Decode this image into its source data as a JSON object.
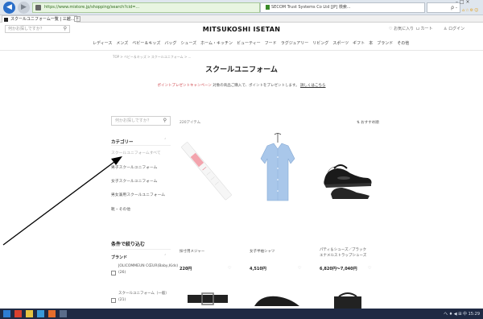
{
  "browser": {
    "url": "https://www.mistore.jp/shopping/search?cid=...",
    "cert_text": "SECOM Trust Systems Co Ltd [JP]",
    "cert_suffix": "検索...",
    "search_placeholder": "ρ -",
    "tab_title": "スクールユニフォーム一覧 | 三越...",
    "win_controls": "– □ ×",
    "toolbar_icons": "⌂☆⚙☺"
  },
  "site": {
    "search_placeholder": "何かお探しですか？",
    "logo": "MITSUKOSHI ISETAN",
    "header_links": [
      "お気に入り",
      "カート",
      "ログイン"
    ],
    "global_nav": [
      "レディース",
      "メンズ",
      "ベビー＆キッズ",
      "バッグ",
      "シューズ",
      "ホーム・キッチン",
      "ビューティー",
      "フード",
      "ラグジュアリー",
      "リビング",
      "スポーツ",
      "ギフト",
      "本",
      "ブランド",
      "その他"
    ],
    "breadcrumb": "TOP > ベビー＆キッズ > スクールユニフォーム > ...",
    "page_title": "スクールユニフォーム",
    "banner": {
      "highlight": "ポイントプレゼントキャンペーン",
      "text": "対象の商品ご購入で、ポイントをプレゼントします。",
      "link": "詳しくはこちら"
    }
  },
  "sidebar": {
    "search_placeholder": "何かお探しですか？",
    "category_heading": "カテゴリー",
    "categories": [
      {
        "label": "スクールユニフォームすべて",
        "current": true
      },
      {
        "label": "男子スクールユニフォーム",
        "current": false
      },
      {
        "label": "女子スクールユニフォーム",
        "current": false
      },
      {
        "label": "男女兼用スクールユニフォーム",
        "current": false
      },
      {
        "label": "靴・その他",
        "current": false
      }
    ],
    "filter_heading": "条件で絞り込む",
    "brand_heading": "ブランド",
    "brands": [
      {
        "label": "JOLICOMMEUN CŒUR(Baby,Kids)",
        "sub": "(26)"
      },
      {
        "label": "スクールユニフォーム（一般）",
        "sub": "(21)"
      }
    ]
  },
  "results": {
    "count": "220アイテム",
    "sort": "おすすめ順"
  },
  "products": [
    {
      "name": "採寸用メジャー",
      "price": "220円"
    },
    {
      "name": "女子半袖シャツ",
      "price": "4,510円"
    },
    {
      "name": "パティ＆シューズ／ブラックエナメルストラップシューズ",
      "price": "6,820円〜7,040円"
    }
  ],
  "taskbar": {
    "tray_text": "へ ♦ ◀ ⊞ 中 15:29"
  },
  "colors": {
    "accent_red": "#d0464c",
    "browser_blue": "#2b6fc9",
    "taskbar": "#1f2a44"
  }
}
